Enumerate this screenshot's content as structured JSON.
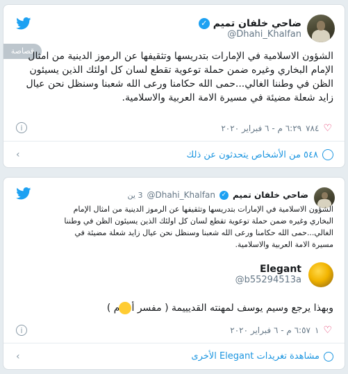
{
  "colors": {
    "twitter_blue": "#1da1f2",
    "link_blue": "#1b95e0",
    "muted": "#657786",
    "like_red": "#e0245e"
  },
  "tweet1": {
    "author_name": "ضاحي خلفان تميم",
    "handle": "@Dhahi_Khalfan",
    "follow_label": "قصاصة مسا",
    "text": "الشؤون الاسلامية في الإمارات بتدريسها وتثقيفها عن الرموز الدينية من امثال الإمام البخاري وغيره ضمن حملة توعوية تقطع لسان كل اولئك الذين يسيئون الظن في وطننا الغالي...حمى الله حكامنا ورعى الله شعبنا وسنظل نحن عيال زايد شعلة مضيئة في مسيرة الامة العربية والاسلامية.",
    "likes": "٧٨٤",
    "timestamp": "٦:٢٩ م - ٦ فبراير ٢٠٢٠",
    "people_talking": "٥٤٨ من الأشخاص يتحدثون عن ذلك"
  },
  "tweet2": {
    "author_name": "ضاحي خلفان تميم",
    "handle": "@Dhahi_Khalfan",
    "age": "3 ين",
    "quoted_text": "الشؤون الاسلامية في الإمارات بتدريسها وتثقيفها عن الرموز الدينية من امثال الإمام البخاري وغيره ضمن حملة توعوية تقطع لسان كل اولئك الذين يسيئون الظن في وطننا الغالي...حمى الله حكامنا ورعى الله شعبنا وسنظل نحن عيال زايد شعلة مضيئة في مسيرة الامة العربية والاسلامية.",
    "reply_author": "Elegant",
    "reply_handle": "@b55294513a",
    "reply_text": "وبهذا يرجع وسيم يوسف لمهنته القديييمة ( مفسر أحلام )",
    "likes": "١",
    "timestamp": "٦:٥٧ م - ٦ فبراير ٢٠٢٠",
    "more_link": "مشاهدة تغريدات Elegant الأخرى"
  },
  "icons": [
    "twitter-bird-icon",
    "verified-badge-icon",
    "heart-icon",
    "info-icon",
    "chevron-icon",
    "laughing-emoji-icon"
  ]
}
